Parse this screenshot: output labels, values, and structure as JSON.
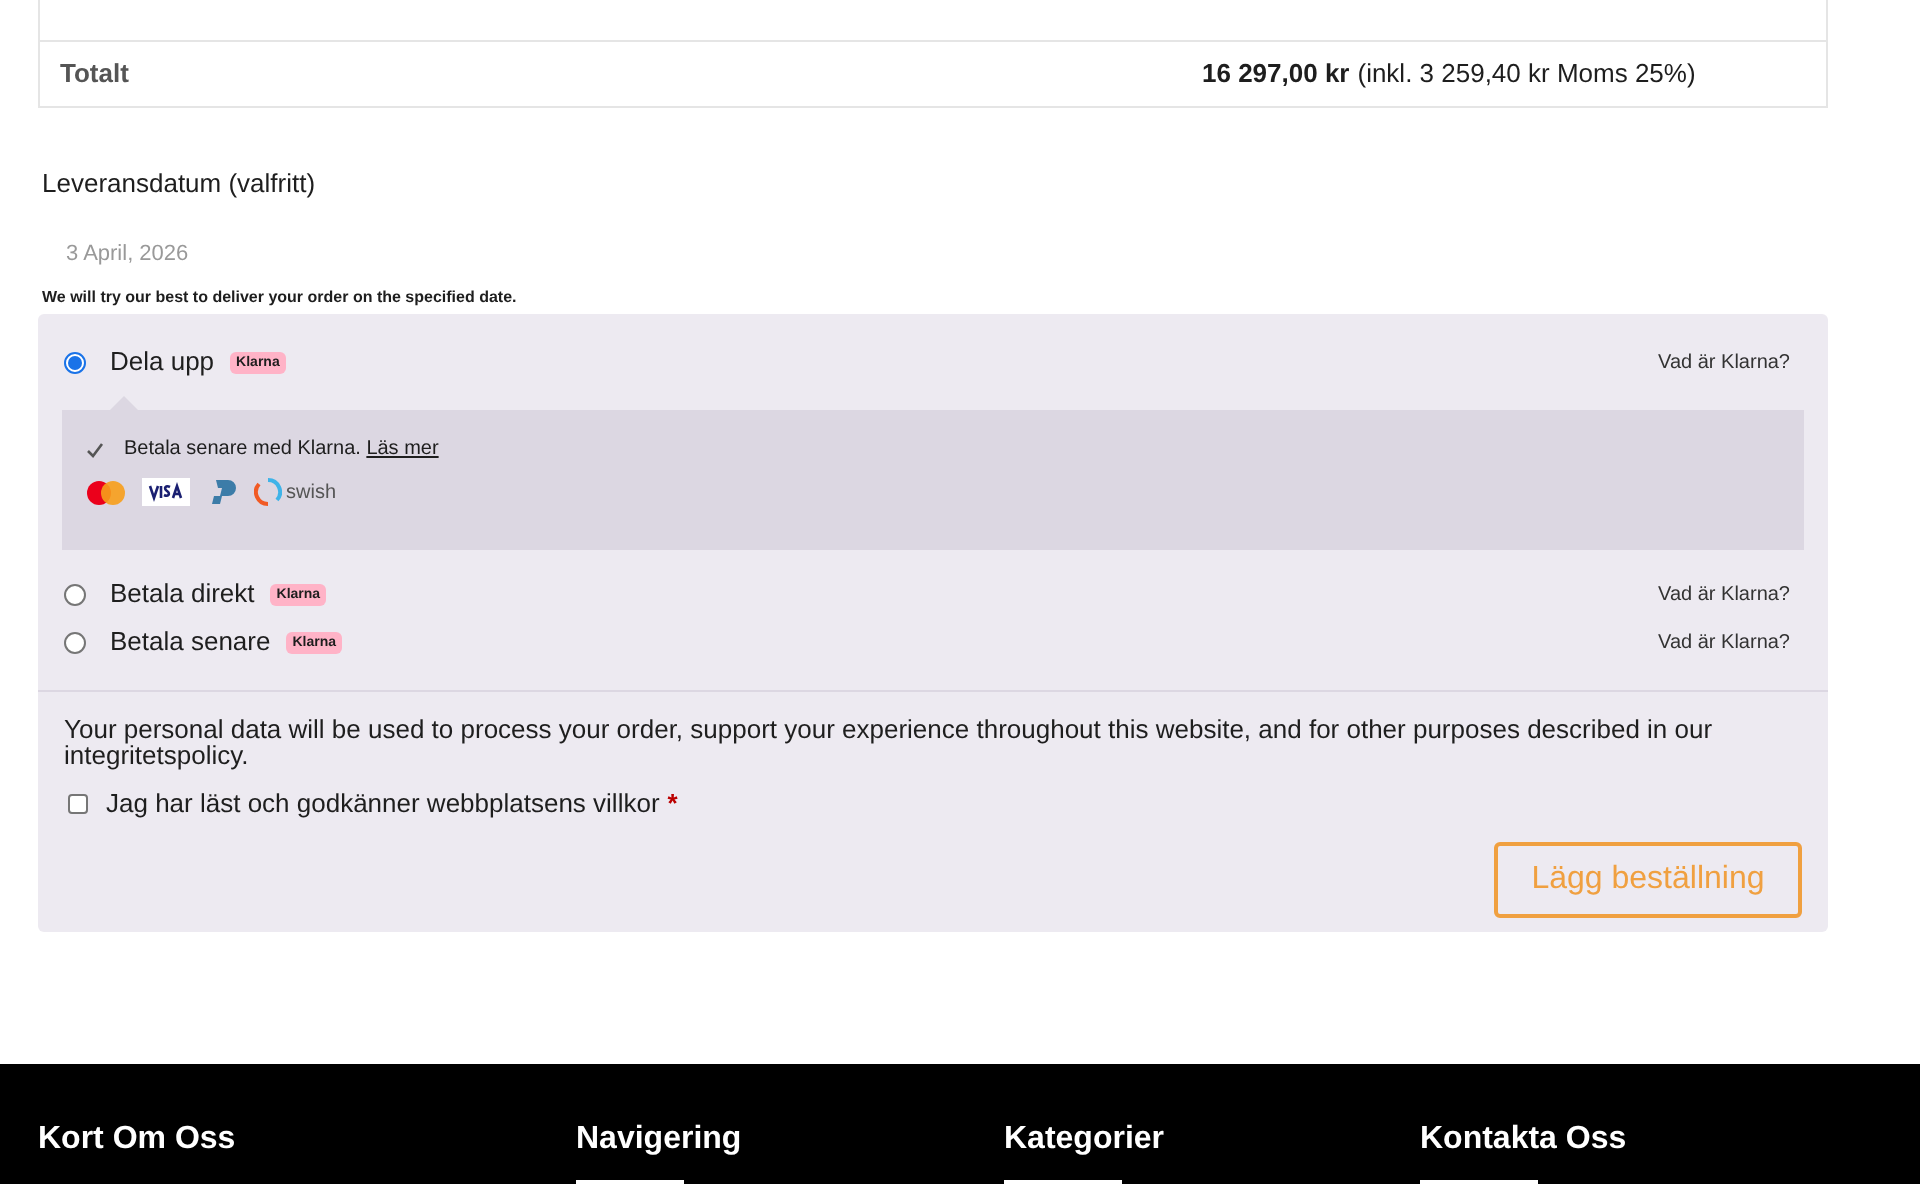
{
  "total": {
    "label": "Totalt",
    "amount": "16 297,00 kr",
    "tax_note": "(inkl. 3 259,40 kr Moms 25%)"
  },
  "delivery_date": {
    "label": "Leveransdatum (valfritt)",
    "value": "3 April, 2026",
    "note": "We will try our best to deliver your order on the specified date."
  },
  "payment_methods": [
    {
      "label": "Dela upp",
      "badge": "Klarna",
      "info_link": "Vad är Klarna?",
      "selected": true,
      "details": {
        "text": "Betala senare med Klarna.",
        "link": "Läs mer",
        "swish_wordmark": "swish"
      }
    },
    {
      "label": "Betala direkt",
      "badge": "Klarna",
      "info_link": "Vad är Klarna?",
      "selected": false
    },
    {
      "label": "Betala senare",
      "badge": "Klarna",
      "info_link": "Vad är Klarna?",
      "selected": false
    }
  ],
  "privacy_text": "Your personal data will be used to process your order, support your experience throughout this website, and for other purposes described in our integritetspolicy.",
  "terms": {
    "label": "Jag har läst och godkänner webbplatsens villkor",
    "required_mark": "*",
    "checked": false
  },
  "place_order_button": "Lägg beställning",
  "footer": {
    "headings": [
      "Kort Om Oss",
      "Navigering",
      "Kategorier",
      "Kontakta Oss"
    ]
  }
}
